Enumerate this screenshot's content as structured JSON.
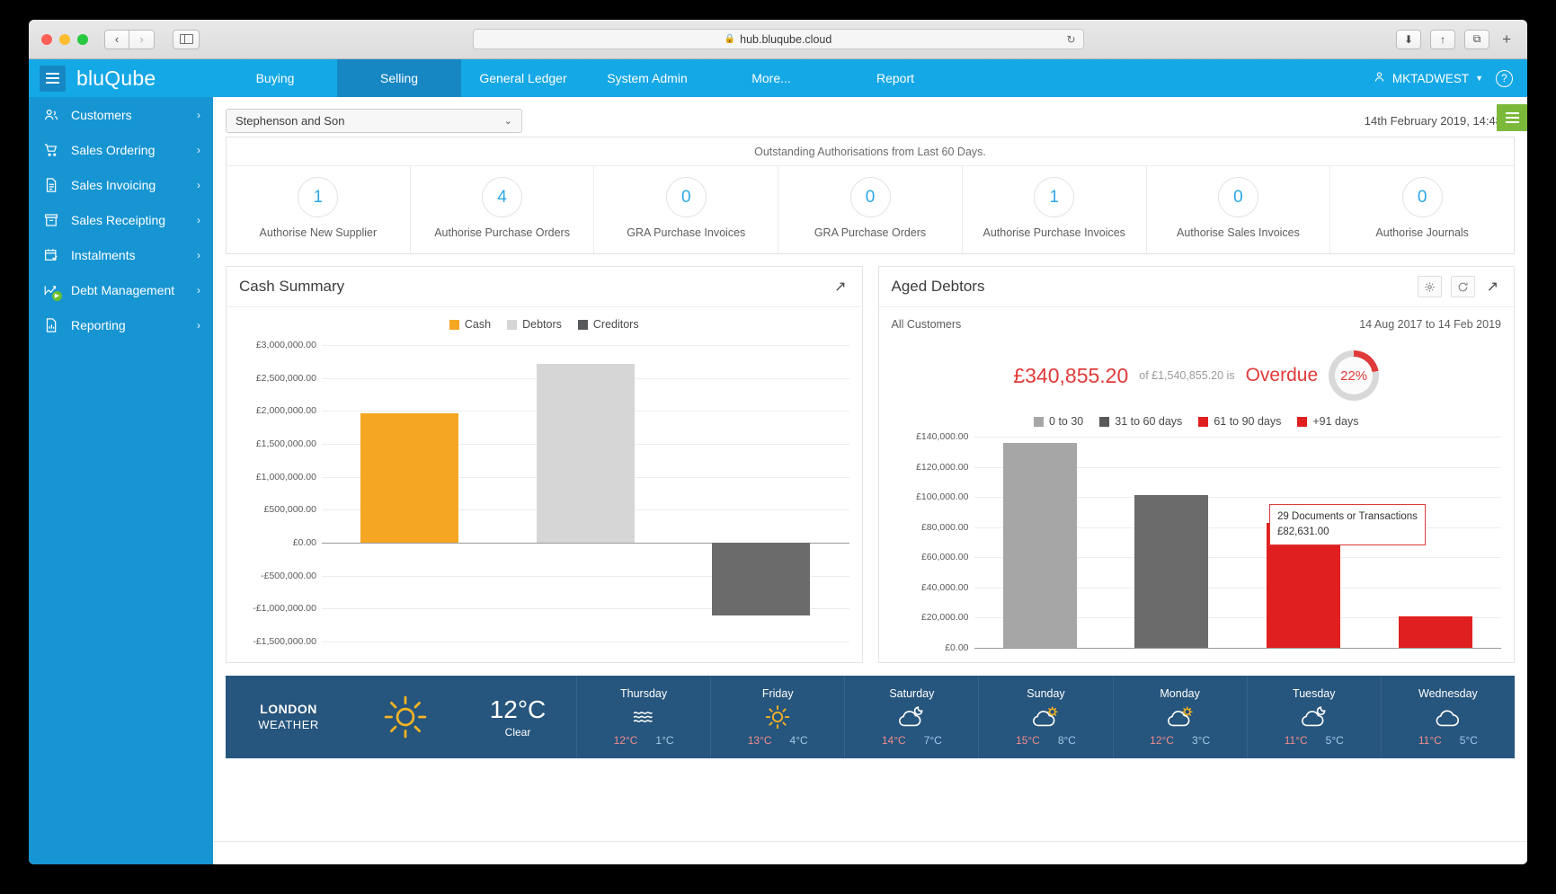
{
  "browser": {
    "url": "hub.bluqube.cloud",
    "lock_icon": "lock-icon",
    "back_icon": "‹",
    "forward_icon": "›",
    "reload_icon": "↻",
    "download_icon": "⬇",
    "share_icon": "↑",
    "tabs_icon": "⧉",
    "newtab_icon": "+"
  },
  "topbar": {
    "brand": "bluQube",
    "nav": [
      {
        "label": "Buying",
        "active": false
      },
      {
        "label": "Selling",
        "active": true
      },
      {
        "label": "General Ledger",
        "active": false
      },
      {
        "label": "System Admin",
        "active": false
      },
      {
        "label": "More...",
        "active": false
      },
      {
        "label": "Report",
        "active": false
      }
    ],
    "user": "MKTADWEST",
    "user_caret": "▼",
    "help": "?"
  },
  "sidebar": {
    "items": [
      {
        "label": "Customers",
        "icon": "people-icon"
      },
      {
        "label": "Sales Ordering",
        "icon": "cart-icon"
      },
      {
        "label": "Sales Invoicing",
        "icon": "document-icon"
      },
      {
        "label": "Sales Receipting",
        "icon": "archive-icon"
      },
      {
        "label": "Instalments",
        "icon": "calendar-check-icon"
      },
      {
        "label": "Debt Management",
        "icon": "trend-chart-icon"
      },
      {
        "label": "Reporting",
        "icon": "report-icon"
      }
    ],
    "chevron": "›"
  },
  "filter": {
    "company": "Stephenson and Son",
    "chevron": "⌄",
    "timestamp": "14th February 2019, 14:48"
  },
  "authorisations": {
    "title": "Outstanding Authorisations from Last 60 Days.",
    "cards": [
      {
        "count": "1",
        "label": "Authorise New Supplier"
      },
      {
        "count": "4",
        "label": "Authorise Purchase Orders"
      },
      {
        "count": "0",
        "label": "GRA Purchase Invoices"
      },
      {
        "count": "0",
        "label": "GRA Purchase Orders"
      },
      {
        "count": "1",
        "label": "Authorise Purchase Invoices"
      },
      {
        "count": "0",
        "label": "Authorise Sales Invoices"
      },
      {
        "count": "0",
        "label": "Authorise Journals"
      }
    ]
  },
  "cash_summary": {
    "title": "Cash Summary",
    "expand_icon": "↗"
  },
  "aged_debtors": {
    "title": "Aged Debtors",
    "settings_icon": "gear-icon",
    "refresh_icon": "refresh-icon",
    "expand_icon": "↗",
    "scope": "All Customers",
    "date_range": "14 Aug 2017 to 14 Feb 2019",
    "overdue_amount": "£340,855.20",
    "overdue_of": "of £1,540,855.20 is",
    "overdue_word": "Overdue",
    "overdue_pct": "22%",
    "tooltip": {
      "line1": "29 Documents or Transactions",
      "line2": "£82,631.00"
    }
  },
  "chart_data": [
    {
      "type": "bar",
      "title": "Cash Summary",
      "categories": [
        "Cash",
        "Debtors",
        "Creditors"
      ],
      "values": [
        1960000,
        2710000,
        -1100000
      ],
      "colors": [
        "#f5a623",
        "#d6d6d6",
        "#6b6b6b"
      ],
      "legend": [
        "Cash",
        "Debtors",
        "Creditors"
      ],
      "legend_position": "top-center",
      "xlabel": "",
      "ylabel": "",
      "ylim": [
        -1500000,
        3000000
      ],
      "ticks": [
        "£3,000,000.00",
        "£2,500,000.00",
        "£2,000,000.00",
        "£1,500,000.00",
        "£1,000,000.00",
        "£500,000.00",
        "£0.00",
        "-£500,000.00",
        "-£1,000,000.00",
        "-£1,500,000.00"
      ],
      "tick_values": [
        3000000,
        2500000,
        2000000,
        1500000,
        1000000,
        500000,
        0,
        -500000,
        -1000000,
        -1500000
      ],
      "grid": true
    },
    {
      "type": "bar",
      "title": "Aged Debtors",
      "categories": [
        "0 to 30",
        "31 to 60 days",
        "61 to 90 days",
        "+91 days"
      ],
      "values": [
        136000,
        101000,
        82631,
        20500
      ],
      "colors": [
        "#a6a6a6",
        "#6b6b6b",
        "#e03a3a",
        "#e03a3a"
      ],
      "legend": [
        "0 to 30",
        "31 to 60 days",
        "61 to 90 days",
        "+91 days"
      ],
      "legend_position": "top-center",
      "xlabel": "",
      "ylabel": "",
      "ylim": [
        0,
        140000
      ],
      "ticks": [
        "£140,000.00",
        "£120,000.00",
        "£100,000.00",
        "£80,000.00",
        "£60,000.00",
        "£40,000.00",
        "£20,000.00",
        "£0.00"
      ],
      "tick_values": [
        140000,
        120000,
        100000,
        80000,
        60000,
        40000,
        20000,
        0
      ],
      "grid": true,
      "annotation": "29 Documents or Transactions £82,631.00"
    }
  ],
  "weather": {
    "city_line1": "LONDON",
    "city_line2": "WEATHER",
    "current_icon": "sun-icon",
    "current_temp": "12°C",
    "current_desc": "Clear",
    "days": [
      {
        "name": "Thursday",
        "icon": "mist-icon",
        "high": "12°C",
        "low": "1°C"
      },
      {
        "name": "Friday",
        "icon": "sun-icon",
        "high": "13°C",
        "low": "4°C"
      },
      {
        "name": "Saturday",
        "icon": "cloud-moon-icon",
        "high": "14°C",
        "low": "7°C"
      },
      {
        "name": "Sunday",
        "icon": "cloud-sun-icon",
        "high": "15°C",
        "low": "8°C"
      },
      {
        "name": "Monday",
        "icon": "cloud-sun-icon",
        "high": "12°C",
        "low": "3°C"
      },
      {
        "name": "Tuesday",
        "icon": "cloud-moon-icon",
        "high": "11°C",
        "low": "5°C"
      },
      {
        "name": "Wednesday",
        "icon": "cloud-icon",
        "high": "11°C",
        "low": "5°C"
      }
    ]
  },
  "colors": {
    "brand_blue": "#15a8e6",
    "brand_blue_dark": "#1787c4",
    "sidebar_blue": "#1795d3",
    "accent_green": "#7cb93a",
    "cash_orange": "#f5a623",
    "debtors_grey": "#d6d6d6",
    "creditors_dark": "#6b6b6b",
    "overdue_red": "#e03a3a",
    "weather_bg": "#26557d"
  }
}
